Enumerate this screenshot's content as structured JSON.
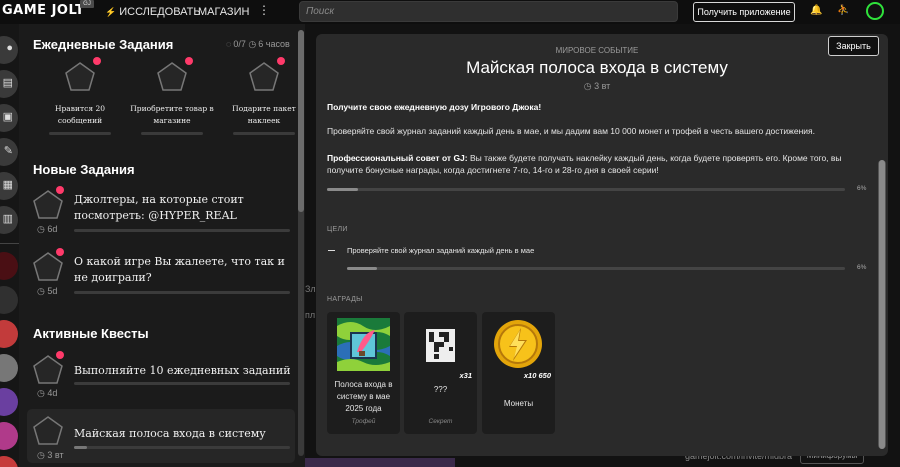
{
  "topbar": {
    "logo": "GAME JOLT",
    "logo_badge": "GJ",
    "explore": "ИССЛЕДОВАТЬ",
    "store": "МАГАЗИН",
    "more_icon": "kebab-icon",
    "search_placeholder": "Поиск",
    "get_app": "Получить приложение"
  },
  "quests_panel": {
    "daily": {
      "title": "Ежедневные Задания",
      "count": "0/7",
      "timer": "6 часов",
      "items": [
        {
          "label": "Нравится 20 сообщений"
        },
        {
          "label": "Приобретите товар в магазине"
        },
        {
          "label": "Подарите пакет наклеек"
        }
      ]
    },
    "new": {
      "title": "Новые Задания",
      "items": [
        {
          "title": "Джолтеры, на которые стоит посмотреть: @HYPER_REAL",
          "time": "6d",
          "progress": 0
        },
        {
          "title": "О какой игре Вы жалеете, что так и не доиграли?",
          "time": "5d",
          "progress": 0
        }
      ]
    },
    "active": {
      "title": "Активные Квесты",
      "items": [
        {
          "title": "Выполняйте 10 ежедневных заданий",
          "time": "4d",
          "progress": 0
        },
        {
          "title": "Майская полоса входа в систему",
          "time": "3 вт",
          "progress": 0.06
        }
      ]
    }
  },
  "background": {
    "peek1": "Зл",
    "peek2": "пл",
    "url": "gamejolt.com/invite/midbra",
    "button": "Минифорумы"
  },
  "modal": {
    "close": "Закрыть",
    "kicker": "МИРОВОЕ СОБЫТИЕ",
    "title": "Майская полоса входа в систему",
    "time": "3 вт",
    "intro": "Получите свою ежедневную дозу Игрового Джока!",
    "description": "Проверяйте свой журнал заданий каждый день в мае, и мы дадим вам 10 000 монет и трофей в честь вашего достижения.",
    "tip_label": "Профессиональный совет от GJ:",
    "tip_text": " Вы также будете получать наклейку каждый день, когда будете проверять его.  Кроме того, вы получите бонусные награды, когда достигнете 7-го, 14-го и 28-го дня в своей серии!",
    "progress": 0.06,
    "progress_label": "6%",
    "goals_label": "ЦЕЛИ",
    "goal": {
      "text": "Проверяйте свой журнал заданий каждый день в мае",
      "progress": 0.06,
      "progress_label": "6%"
    },
    "rewards_label": "НАГРАДЫ",
    "rewards": [
      {
        "name": "Полоса входа в систему в мае 2025 года",
        "type": "Трофей",
        "qty": ""
      },
      {
        "name": "???",
        "type": "Секрет",
        "qty": "x31"
      },
      {
        "name": "Монеты",
        "type": "",
        "qty": "x10 650"
      }
    ]
  },
  "colors": {
    "accent_green": "#2fe23b",
    "notification_dot": "#ff3a6a"
  }
}
